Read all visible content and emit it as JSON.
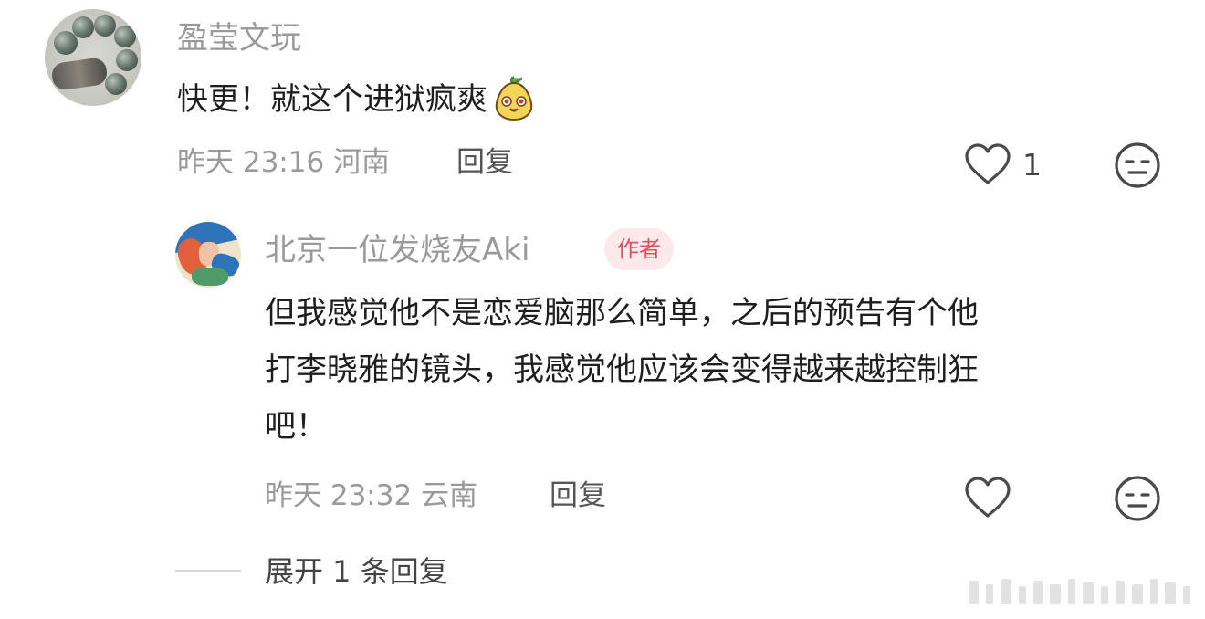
{
  "comment": {
    "username": "盈莹文玩",
    "text": "快更！就这个进狱疯爽",
    "time": "昨天 23:16",
    "location": "河南",
    "reply_label": "回复",
    "like_count": "1"
  },
  "reply": {
    "username": "北京一位发烧友Aki",
    "badge": "作者",
    "text_lines": [
      "但我感觉他不是恋爱脑那么简单，之后的预告有个他",
      "打李晓雅的镜头，我感觉他应该会变得越来越控制狂",
      "吧！"
    ],
    "time": "昨天 23:32",
    "location": "云南",
    "reply_label": "回复"
  },
  "expand_label": "展开 1 条回复",
  "icons": {
    "like": "heart-icon",
    "dislike": "meh-face-icon",
    "emoji": "pear-emoji-icon"
  },
  "colors": {
    "meta_gray": "#9a9a9a",
    "badge_bg": "#fbe9ec",
    "badge_text": "#e0515f"
  }
}
